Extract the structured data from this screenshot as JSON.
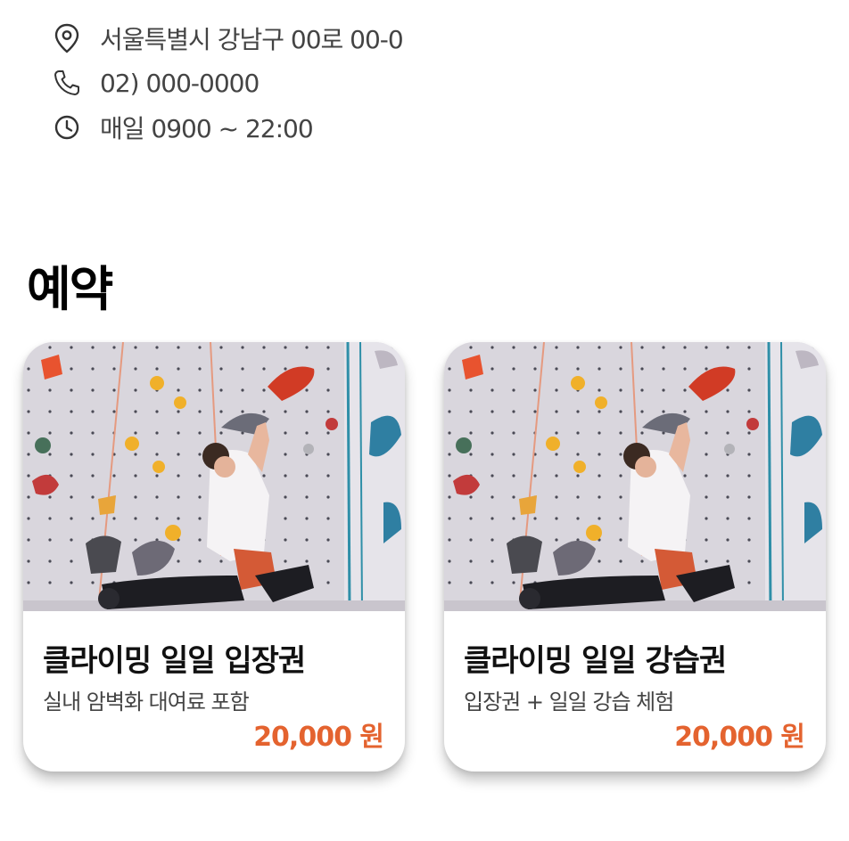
{
  "info": {
    "address": "서울특별시 강남구 00로 00-0",
    "phone": "02) 000-0000",
    "hours": "매일 0900 ~ 22:00",
    "icons": [
      "location-pin-icon",
      "phone-icon",
      "clock-icon"
    ]
  },
  "reservation": {
    "title": "예약",
    "cards": [
      {
        "name": "클라이밍 일일 입장권",
        "desc": "실내 암벽화 대여료 포함",
        "price": "20,000 원"
      },
      {
        "name": "클라이밍 일일 강습권",
        "desc": "입장권 + 일일 강습 체험",
        "price": "20,000 원"
      }
    ]
  },
  "colors": {
    "accent": "#e4632f",
    "title": "#000000",
    "text": "#444444"
  }
}
